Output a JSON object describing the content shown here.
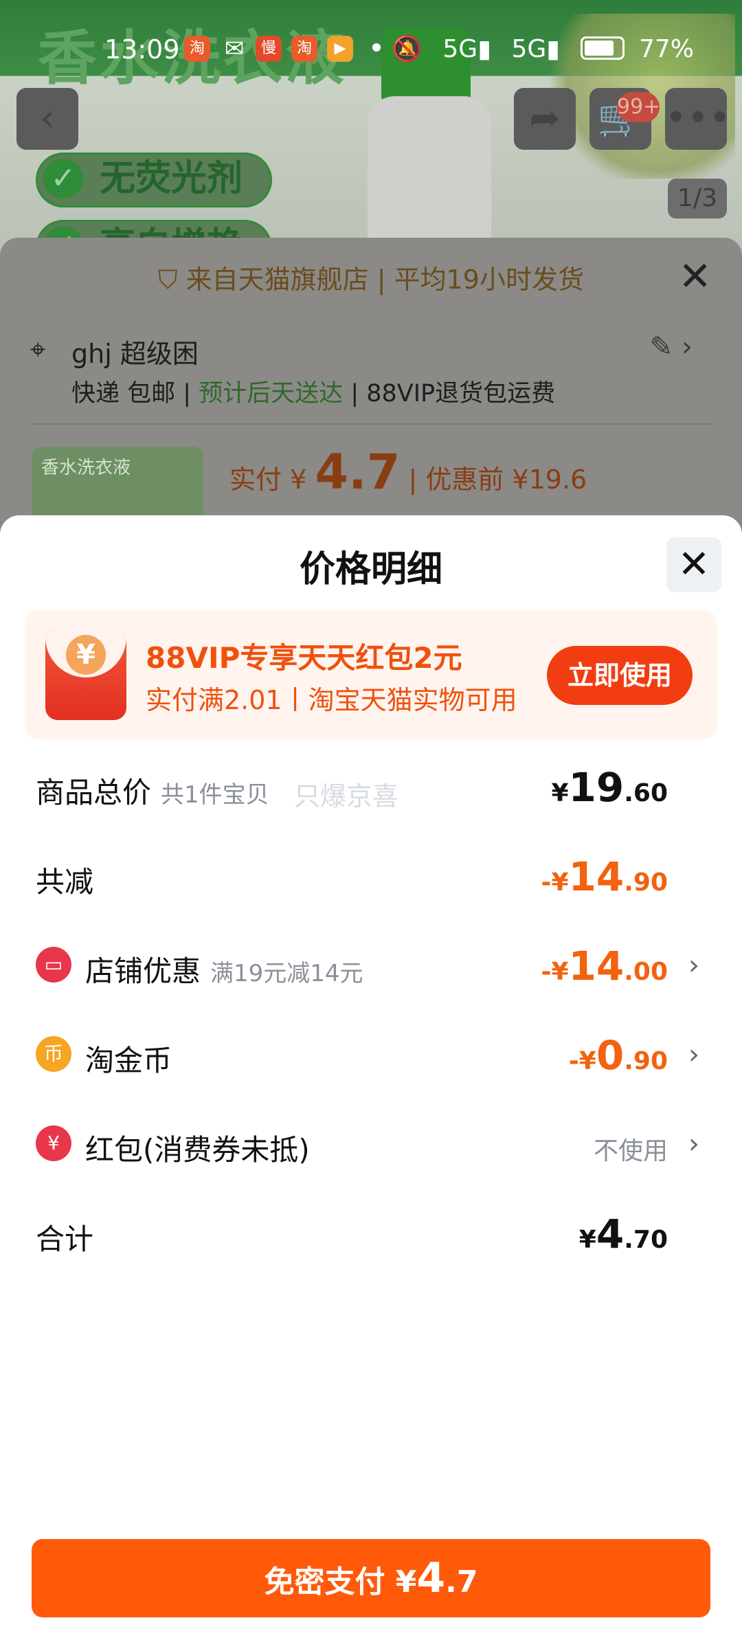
{
  "status_bar": {
    "time": "13:09",
    "battery": "77%",
    "signal1": "5G",
    "signal2": "5G"
  },
  "background": {
    "banner_text": "香水洗衣液",
    "tags": [
      "无荧光剂",
      "亮白增艳"
    ],
    "cart_badge": "99+",
    "image_pager": "1/3"
  },
  "order_sheet": {
    "store_line": "来自天猫旗舰店",
    "ship_time": "平均19小时发货",
    "address": "ghj 超级困",
    "ship_method": "快递 包邮",
    "delivery": "预计后天送达",
    "return_fee": "88VIP退货包运费",
    "thumb_text": "香水洗衣液",
    "price_label": "实付 ¥",
    "price_value": "4.7",
    "before_label": "优惠前 ¥19.6"
  },
  "price_detail": {
    "title": "价格明细",
    "promo": {
      "title": "88VIP专享天天红包2元",
      "subtitle": "实付满2.01丨淘宝天猫实物可用",
      "button": "立即使用"
    },
    "watermark": "只爆京喜",
    "rows": [
      {
        "label": "商品总价",
        "note": "共1件宝贝",
        "sign": "",
        "sym": "¥",
        "int": "19",
        "dec": ".60"
      },
      {
        "label": "共减",
        "note": "",
        "sign": "-",
        "sym": "¥",
        "int": "14",
        "dec": ".90"
      },
      {
        "label": "店铺优惠",
        "note": "满19元减14元",
        "sign": "-",
        "sym": "¥",
        "int": "14",
        "dec": ".00"
      },
      {
        "label": "淘金币",
        "note": "",
        "sign": "-",
        "sym": "¥",
        "int": "0",
        "dec": ".90"
      },
      {
        "label": "红包(消费券未抵)",
        "note": "",
        "value": "不使用"
      },
      {
        "label": "合计",
        "note": "",
        "sign": "",
        "sym": "¥",
        "int": "4",
        "dec": ".70"
      }
    ],
    "icons": {
      "store": "#e8364a",
      "coin": "#f6a524",
      "redpacket": "#e8364a"
    },
    "pay_button": {
      "label": "免密支付 ¥",
      "int": "4",
      "dec": ".7"
    }
  }
}
